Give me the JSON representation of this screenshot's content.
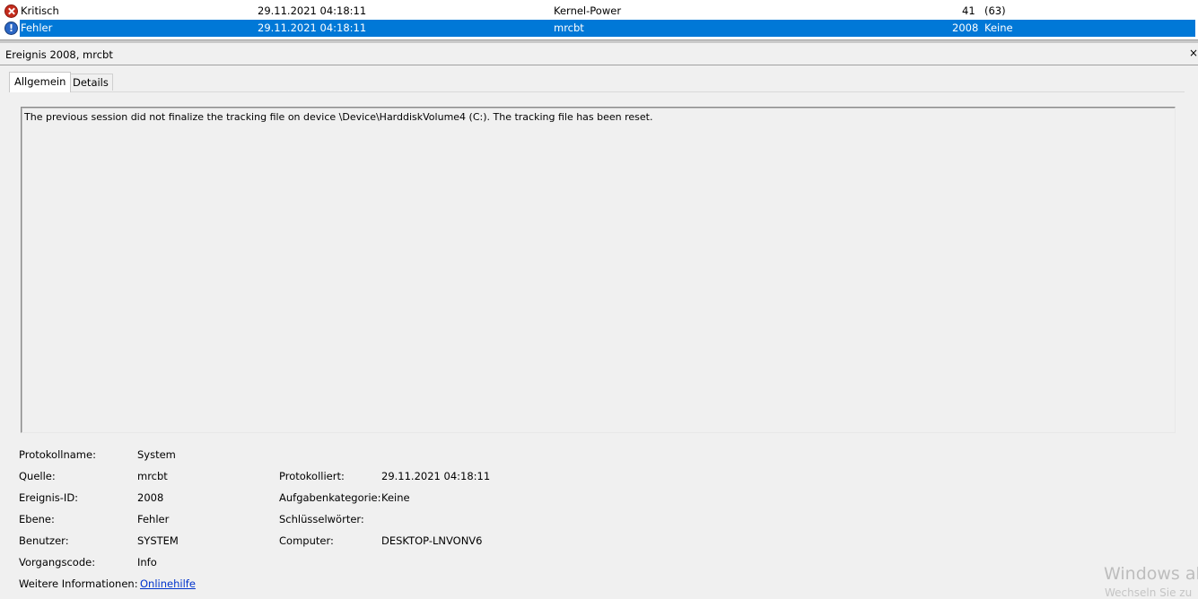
{
  "events": [
    {
      "level": "Kritisch",
      "date": "29.11.2021 04:18:11",
      "source": "Kernel-Power",
      "id": "41",
      "category": "(63)",
      "icon": "critical-error-icon"
    },
    {
      "level": "Fehler",
      "date": "29.11.2021 04:18:11",
      "source": "mrcbt",
      "id": "2008",
      "category": "Keine",
      "icon": "error-info-icon"
    }
  ],
  "detail": {
    "title": "Ereignis 2008, mrcbt",
    "close_glyph": "×",
    "tabs": [
      {
        "label": "Allgemein"
      },
      {
        "label": "Details"
      }
    ],
    "description": "The previous session did not finalize the tracking file on device \\Device\\HarddiskVolume4 (C:). The tracking file has been reset.",
    "props": {
      "protokollname_label": "Protokollname:",
      "protokollname_value": "System",
      "quelle_label": "Quelle:",
      "quelle_value": "mrcbt",
      "protokolliert_label": "Protokolliert:",
      "protokolliert_value": "29.11.2021 04:18:11",
      "ereignisid_label": "Ereignis-ID:",
      "ereignisid_value": "2008",
      "aufgabenkategorie_label": "Aufgabenkategorie:",
      "aufgabenkategorie_value": "Keine",
      "ebene_label": "Ebene:",
      "ebene_value": "Fehler",
      "schluesselwoerter_label": "Schlüsselwörter:",
      "benutzer_label": "Benutzer:",
      "benutzer_value": "SYSTEM",
      "computer_label": "Computer:",
      "computer_value": "DESKTOP-LNVONV6",
      "vorgangscode_label": "Vorgangscode:",
      "vorgangscode_value": "Info",
      "weitere_label": "Weitere Informationen:",
      "weitere_link": "Onlinehilfe"
    }
  },
  "watermark": {
    "line1": "Windows ak",
    "line2": "Wechseln Sie zu"
  },
  "colors": {
    "selection": "#0078d7",
    "link": "#0033cc"
  }
}
